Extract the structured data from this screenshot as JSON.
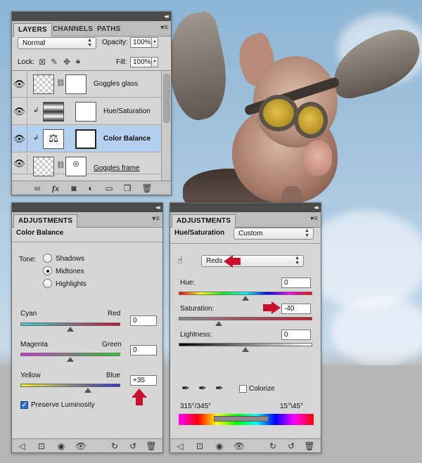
{
  "colors": {
    "panel_bg": "#d6d6d6",
    "selected_row": "#b4cff0",
    "annotation_red": "#c8102e"
  },
  "layers_panel": {
    "tabs": [
      "LAYERS",
      "CHANNELS",
      "PATHS"
    ],
    "blend_mode": "Normal",
    "opacity_label": "Opacity:",
    "opacity_value": "100%",
    "lock_label": "Lock:",
    "fill_label": "Fill:",
    "fill_value": "100%",
    "layers": [
      {
        "name": "Goggles glass",
        "visible": true,
        "selected": false,
        "clipped": false
      },
      {
        "name": "Hue/Saturation",
        "visible": true,
        "selected": false,
        "clipped": true
      },
      {
        "name": "Color Balance",
        "visible": true,
        "selected": true,
        "clipped": true
      },
      {
        "name": "Goggles frame",
        "visible": true,
        "selected": false,
        "clipped": false
      }
    ],
    "bottom_icons": [
      "link-icon",
      "fx-icon",
      "mask-icon",
      "adjustment-icon",
      "group-icon",
      "new-layer-icon",
      "trash-icon"
    ],
    "fx_label": "fx"
  },
  "color_balance_panel": {
    "tab": "ADJUSTMENTS",
    "title": "Color Balance",
    "tone_label": "Tone:",
    "tones": [
      "Shadows",
      "Midtones",
      "Highlights"
    ],
    "selected_tone": "Midtones",
    "sliders": [
      {
        "left": "Cyan",
        "right": "Red",
        "value": "0",
        "level": 0
      },
      {
        "left": "Magenta",
        "right": "Green",
        "value": "0",
        "level": 0
      },
      {
        "left": "Yellow",
        "right": "Blue",
        "value": "+35",
        "level": 35
      }
    ],
    "preserve_luminosity_label": "Preserve Luminosity",
    "preserve_luminosity": true
  },
  "hue_saturation_panel": {
    "tab": "ADJUSTMENTS",
    "title": "Hue/Saturation",
    "preset": "Custom",
    "channel": "Reds",
    "hue_label": "Hue:",
    "hue_value": "0",
    "hue_level": 0,
    "saturation_label": "Saturation:",
    "saturation_value": "-40",
    "saturation_level": -40,
    "lightness_label": "Lightness:",
    "lightness_value": "0",
    "lightness_level": 0,
    "colorize_label": "Colorize",
    "colorize": false,
    "range_left": "315°/345°",
    "range_right": "15°\\45°"
  }
}
